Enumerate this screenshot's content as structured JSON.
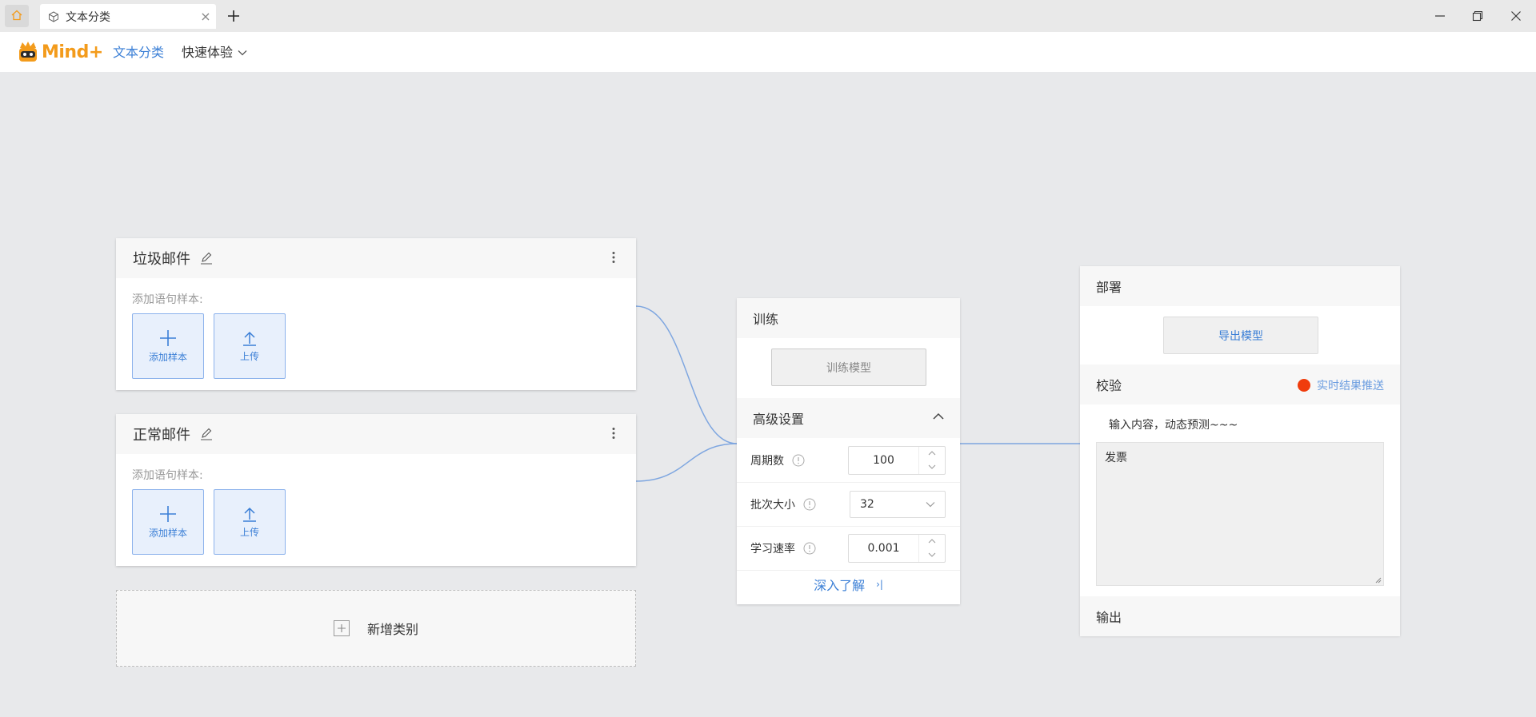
{
  "window": {
    "tab_title": "文本分类",
    "tab_close": "×",
    "new_tab": "+"
  },
  "app": {
    "logo_text": "Mind+",
    "nav": {
      "current": "文本分类",
      "quick": "快速体验"
    }
  },
  "classes": [
    {
      "name": "垃圾邮件",
      "sample_label": "添加语句样本:",
      "add_sample": "添加样本",
      "upload": "上传"
    },
    {
      "name": "正常邮件",
      "sample_label": "添加语句样本:",
      "add_sample": "添加样本",
      "upload": "上传"
    }
  ],
  "add_class_label": "新增类别",
  "train": {
    "title": "训练",
    "train_button": "训练模型",
    "advanced_title": "高级设置",
    "params": [
      {
        "label": "周期数",
        "value": "100",
        "type": "number"
      },
      {
        "label": "批次大小",
        "value": "32",
        "type": "select"
      },
      {
        "label": "学习速率",
        "value": "0.001",
        "type": "number"
      }
    ],
    "learn_more": "深入了解",
    "learn_more_icon": "›|"
  },
  "deploy": {
    "title": "部署",
    "export_button": "导出模型",
    "verify_title": "校验",
    "realtime_label": "实时结果推送",
    "prompt": "输入内容，动态预测~~~",
    "input_value": "发票",
    "output_title": "输出"
  },
  "colors": {
    "accent": "#3b7fd6",
    "logo": "#f39b1b",
    "realtime_dot": "#f03c0c",
    "link_line": "#7ea6e0"
  }
}
